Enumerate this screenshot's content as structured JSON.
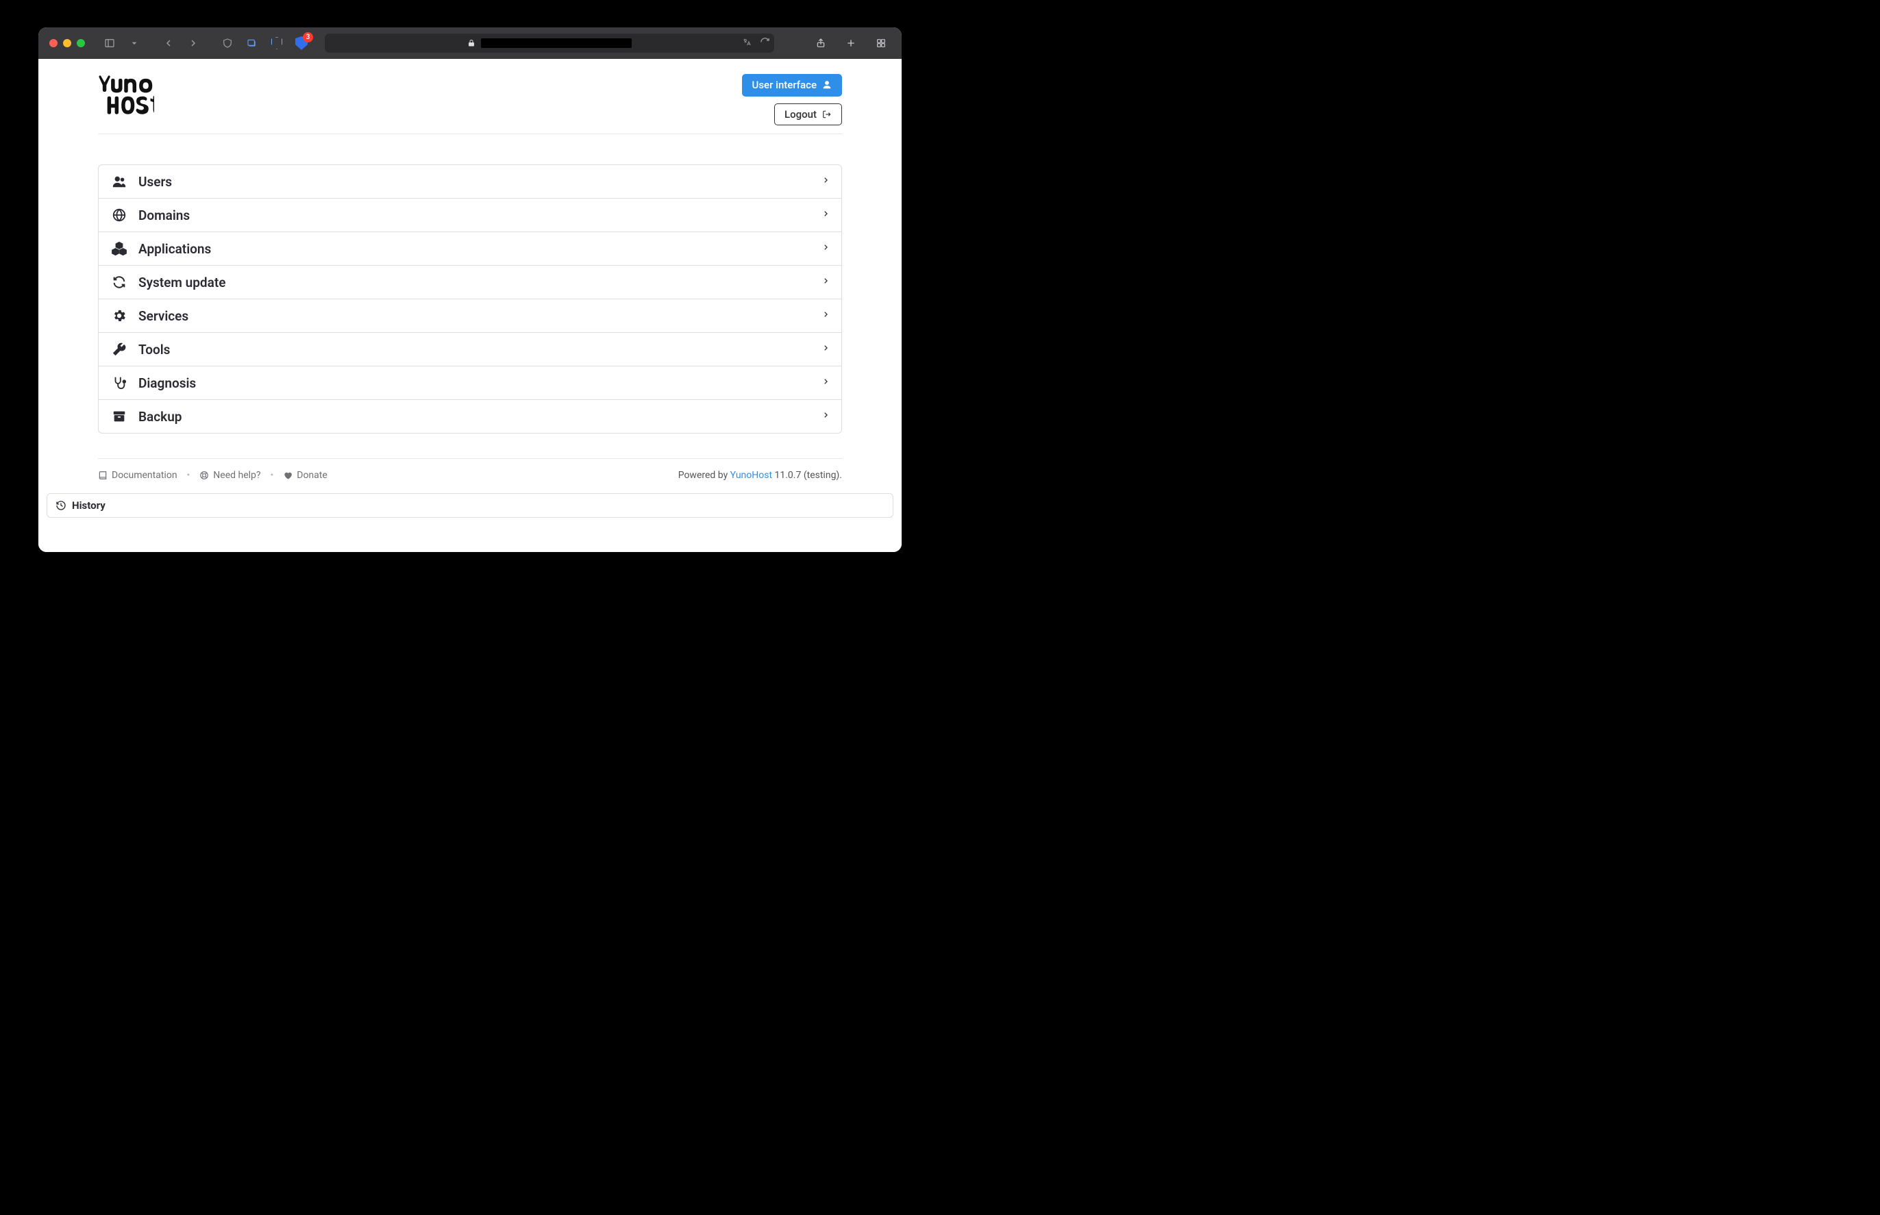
{
  "browser": {
    "ext_badge": "3"
  },
  "header": {
    "user_interface_label": "User interface",
    "logout_label": "Logout"
  },
  "menu": {
    "items": [
      {
        "label": "Users"
      },
      {
        "label": "Domains"
      },
      {
        "label": "Applications"
      },
      {
        "label": "System update"
      },
      {
        "label": "Services"
      },
      {
        "label": "Tools"
      },
      {
        "label": "Diagnosis"
      },
      {
        "label": "Backup"
      }
    ]
  },
  "footer": {
    "documentation": "Documentation",
    "need_help": "Need help?",
    "donate": "Donate",
    "powered_by_prefix": "Powered by ",
    "powered_by_link": "YunoHost",
    "version_suffix": " 11.0.7 (testing)."
  },
  "history": {
    "label": "History"
  }
}
